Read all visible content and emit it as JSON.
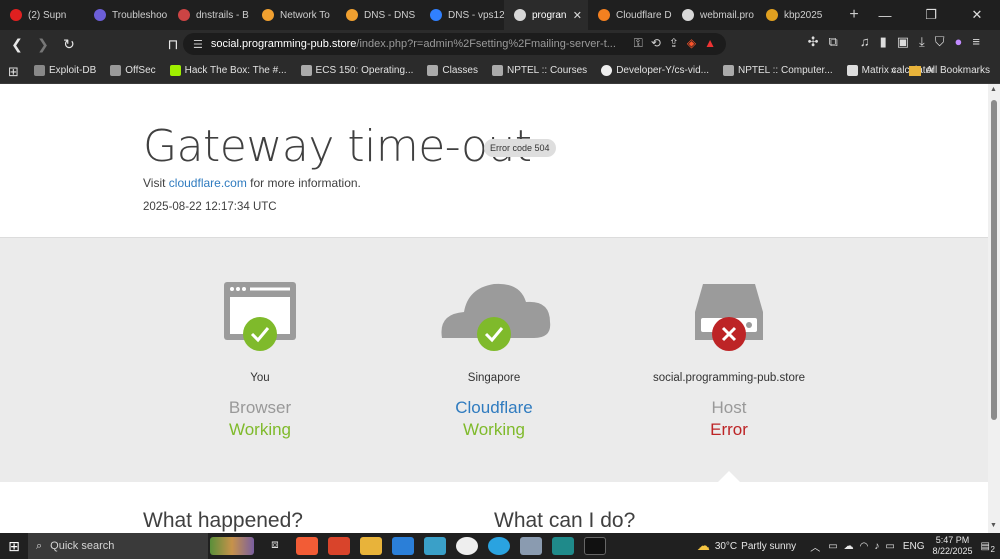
{
  "browser": {
    "tabs": [
      {
        "label": "(2) Supn",
        "color": "#e02020"
      },
      {
        "label": "Troubleshoo",
        "color": "#6d5fd8"
      },
      {
        "label": "dnstrails - B",
        "color": "#cc4444"
      },
      {
        "label": "Network To",
        "color": "#f0a030"
      },
      {
        "label": "DNS - DNS",
        "color": "#f0a030"
      },
      {
        "label": "DNS - vps12",
        "color": "#3080ff"
      },
      {
        "label": "progran",
        "color": "#d8d8d8",
        "active": true
      },
      {
        "label": "Cloudflare D",
        "color": "#f38020"
      },
      {
        "label": "webmail.pro",
        "color": "#d8d8d8"
      },
      {
        "label": "kbp2025",
        "color": "#e0a020"
      }
    ],
    "url_host": "social.programming-pub.store",
    "url_path": "/index.php?r=admin%2Fsetting%2Fmailing-server-t...",
    "bookmarks": [
      {
        "label": "Exploit-DB"
      },
      {
        "label": "OffSec"
      },
      {
        "label": "Hack The Box: The #..."
      },
      {
        "label": "ECS 150: Operating..."
      },
      {
        "label": "Classes"
      },
      {
        "label": "NPTEL :: Courses"
      },
      {
        "label": "Developer-Y/cs-vid..."
      },
      {
        "label": "NPTEL :: Computer..."
      },
      {
        "label": "Matrix calculator"
      }
    ],
    "all_bookmarks": "All Bookmarks"
  },
  "error": {
    "title": "Gateway time-out",
    "code_badge": "Error code 504",
    "visit_prefix": "Visit ",
    "visit_link": "cloudflare.com",
    "visit_suffix": " for more information.",
    "timestamp": "2025-08-22 12:17:34 UTC"
  },
  "nodes": [
    {
      "location": "You",
      "name": "Browser",
      "status": "Working",
      "state": "ok"
    },
    {
      "location": "Singapore",
      "name": "Cloudflare",
      "status": "Working",
      "state": "ok"
    },
    {
      "location": "social.programming-pub.store",
      "name": "Host",
      "status": "Error",
      "state": "error"
    }
  ],
  "colors": {
    "ok": "#7fba2b",
    "error": "#bd2426",
    "link": "#2f7bbf",
    "icon_gray": "#9b9b9b"
  },
  "sections": {
    "what_happened": "What happened?",
    "what_can_i_do": "What can I do?"
  },
  "taskbar": {
    "search_placeholder": "Quick search",
    "weather_temp": "30°C",
    "weather_text": "Partly sunny",
    "lang": "ENG",
    "time": "5:47 PM",
    "date": "8/22/2025",
    "notification_count": "2"
  }
}
